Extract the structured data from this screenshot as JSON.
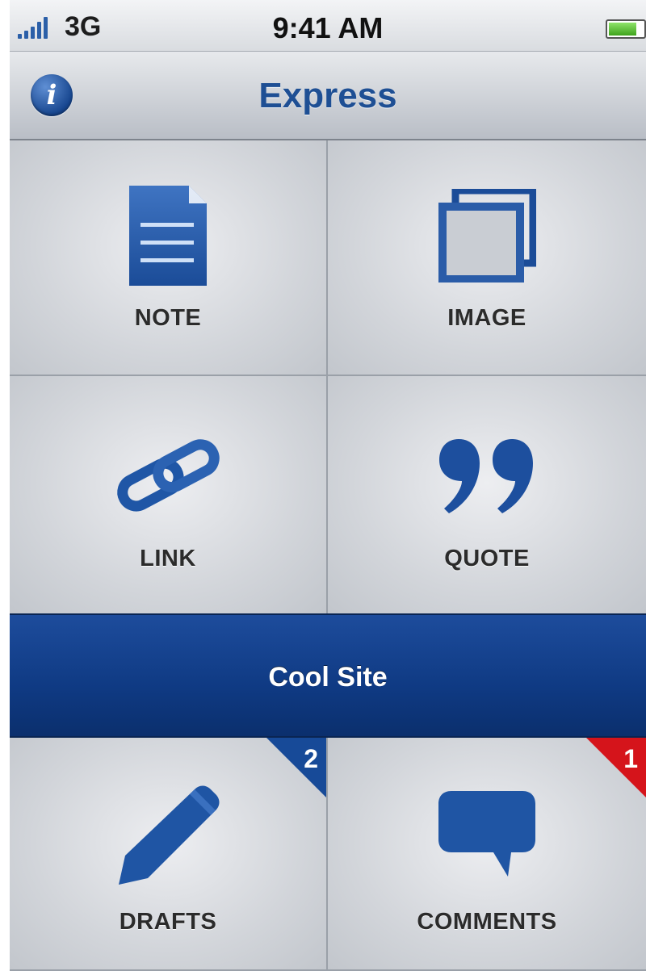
{
  "status_bar": {
    "carrier": "3G",
    "time": "9:41 AM"
  },
  "nav_bar": {
    "title": "Express",
    "info_icon": "info-icon",
    "info_glyph": "i"
  },
  "tiles": {
    "note": {
      "label": "NOTE",
      "icon": "note-icon"
    },
    "image": {
      "label": "IMAGE",
      "icon": "image-icon"
    },
    "link": {
      "label": "LINK",
      "icon": "link-icon"
    },
    "quote": {
      "label": "QUOTE",
      "icon": "quote-icon"
    },
    "drafts": {
      "label": "DRAFTS",
      "icon": "pencil-icon",
      "badge": "2"
    },
    "comments": {
      "label": "COMMENTS",
      "icon": "speech-bubble-icon",
      "badge": "1"
    }
  },
  "site_bar": {
    "name": "Cool Site"
  },
  "colors": {
    "accent_blue": "#1e4f94",
    "site_bar_blue": "#0f3a83",
    "badge_blue": "#174a98",
    "badge_red": "#d5141b"
  }
}
